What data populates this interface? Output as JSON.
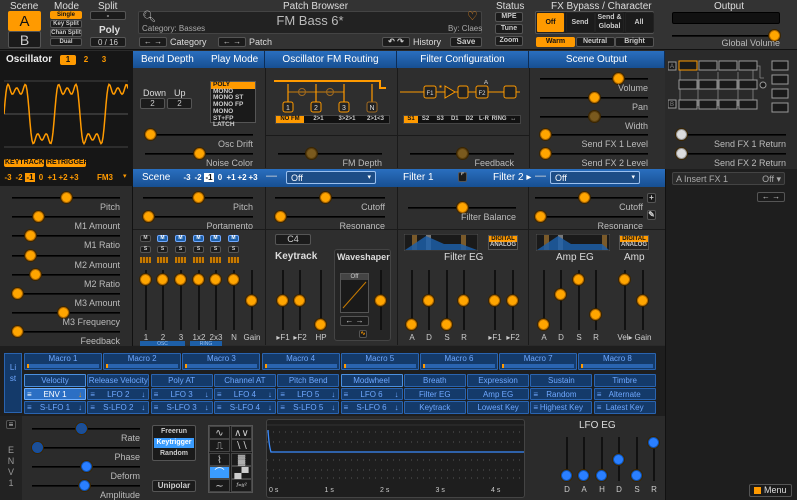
{
  "colors": {
    "accent": "#ff9a00",
    "header_blue": "#1d5fa8",
    "mod_blue": "#143a6a",
    "lfo_blue": "#2a7fff"
  },
  "top": {
    "scene_label": "Scene",
    "scene_a": "A",
    "scene_b": "B",
    "mode_label": "Mode",
    "modes": [
      "Single",
      "Key Split",
      "Chan Split",
      "Dual"
    ],
    "mode_selected": "Single",
    "split_label": "Split",
    "split_value": "-",
    "poly_label": "Poly",
    "poly_value": "0 / 16",
    "patch_browser_label": "Patch Browser",
    "patch_name": "FM Bass 6*",
    "category": "Category: Basses",
    "author": "By: Claes",
    "category_nav": "Category",
    "patch_nav": "Patch",
    "history": "History",
    "save": "Save",
    "status_label": "Status",
    "status_buttons": [
      "MPE",
      "Tune",
      "Zoom"
    ],
    "fx_label": "FX Bypass / Character",
    "fx_bypass": [
      "Off",
      "Send",
      "Send & Global",
      "All"
    ],
    "fx_selected": "Off",
    "character": [
      "Warm",
      "Neutral",
      "Bright"
    ],
    "character_selected": "Warm",
    "output_label": "Output",
    "global_volume": {
      "label": "Global Volume",
      "value": 1.0
    }
  },
  "osc": {
    "title": "Oscillator",
    "tabs": [
      "1",
      "2",
      "3"
    ],
    "selected_tab": "1",
    "keytrack": "KEYTRACK",
    "retrigger": "RETRIGGER",
    "octaves": [
      "-3",
      "-2",
      "-1",
      "0",
      "+1",
      "+2",
      "+3"
    ],
    "octave_selected": "-1",
    "type": "FM3",
    "sliders": [
      {
        "label": "Pitch",
        "value": 0.5
      },
      {
        "label": "M1 Amount",
        "value": 0.22
      },
      {
        "label": "M1 Ratio",
        "value": 0.13
      },
      {
        "label": "M2 Amount",
        "value": 0.13
      },
      {
        "label": "M2 Ratio",
        "value": 0.19
      },
      {
        "label": "M3 Amount",
        "value": 0.0
      },
      {
        "label": "M3 Frequency",
        "value": 0.47
      },
      {
        "label": "Feedback",
        "value": 0.0
      }
    ]
  },
  "headers": {
    "bend": "Bend Depth",
    "play_mode": "Play Mode",
    "fm_routing": "Oscillator FM Routing",
    "filter_config": "Filter Configuration",
    "scene_output": "Scene Output"
  },
  "bend": {
    "down_label": "Down",
    "up_label": "Up",
    "down": "2",
    "up": "2"
  },
  "play_modes": [
    "POLY",
    "MONO",
    "MONO ST",
    "MONO FP",
    "MONO ST+FP",
    "LATCH"
  ],
  "play_mode_selected": "POLY",
  "fm_modes": [
    "NO FM",
    "2>1",
    "3>2>1",
    "2>1<3"
  ],
  "fm_selected": "NO FM",
  "filter_modes": [
    "S1",
    "S2",
    "S3",
    "D1",
    "D2",
    "L-R",
    "RING",
    "↔"
  ],
  "filter_mode_selected": "S1",
  "upper_sliders": {
    "osc_drift": {
      "label": "Osc Drift",
      "value": 0.0
    },
    "noise_color": {
      "label": "Noise Color",
      "value": 0.5
    },
    "fm_depth": {
      "label": "FM Depth",
      "value": 0.3
    },
    "feedback": {
      "label": "Feedback",
      "value": 0.5
    },
    "volume": {
      "label": "Volume",
      "value": 0.75
    },
    "pan": {
      "label": "Pan",
      "value": 0.5
    },
    "width": {
      "label": "Width",
      "value": 0.5
    },
    "send1": {
      "label": "Send FX 1 Level",
      "value": 0.0
    },
    "send2": {
      "label": "Send FX 2 Level",
      "value": 0.0
    },
    "ret1": {
      "label": "Send FX 1 Return",
      "value": 0.0
    },
    "ret2": {
      "label": "Send FX 2 Return",
      "value": 0.0
    }
  },
  "scene_bar": {
    "label": "Scene",
    "octaves": [
      "-3",
      "-2",
      "-1",
      "0",
      "+1",
      "+2",
      "+3"
    ],
    "octave_selected": "-1",
    "filter1_type": "Off",
    "filter1": "Filter 1",
    "filter2": "Filter 2 ▸",
    "filter2_type": "Off"
  },
  "mid_sliders": {
    "pitch": {
      "label": "Pitch",
      "value": 0.5
    },
    "portamento": {
      "label": "Portamento",
      "value": 0.0
    },
    "cutoff1": {
      "label": "Cutoff",
      "value": 0.45
    },
    "res1": {
      "label": "Resonance",
      "value": 0.0
    },
    "balance": {
      "label": "Filter Balance",
      "value": 0.5
    },
    "cutoff2": {
      "label": "Cutoff",
      "value": 0.45
    },
    "res2": {
      "label": "Resonance",
      "value": 0.0
    }
  },
  "mixer": {
    "channels": [
      {
        "label": "1",
        "value": 0.92
      },
      {
        "label": "2",
        "value": 0.92
      },
      {
        "label": "3",
        "value": 0.92
      },
      {
        "label": "1x2",
        "value": 0.92
      },
      {
        "label": "2x3",
        "value": 0.92
      },
      {
        "label": "N",
        "value": 0.92
      },
      {
        "label": "Gain",
        "value": 0.5
      }
    ],
    "mute": "M",
    "solo": "S",
    "osc_group": "OSC",
    "ring_group": "RING"
  },
  "keytrack": {
    "note": "C4",
    "label": "Keytrack",
    "sliders": [
      {
        "label": "▸F1",
        "value": 0.5
      },
      {
        "label": "▸F2",
        "value": 0.5
      },
      {
        "label": "HP",
        "value": 0.0
      }
    ]
  },
  "waveshaper": {
    "label": "Waveshaper",
    "type": "Off",
    "drive": 0.5
  },
  "filter_eg": {
    "label": "Filter EG",
    "digital": "DIGITAL",
    "analog": "ANALOG",
    "sliders": [
      {
        "label": "A",
        "value": 0.0
      },
      {
        "label": "D",
        "value": 0.5
      },
      {
        "label": "S",
        "value": 0.0
      },
      {
        "label": "R",
        "value": 0.5
      },
      {
        "label": "▸F1",
        "value": 0.5
      },
      {
        "label": "▸F2",
        "value": 0.5
      }
    ]
  },
  "amp_eg": {
    "label": "Amp EG",
    "amp_label": "Amp",
    "digital": "DIGITAL",
    "analog": "ANALOG",
    "sliders": [
      {
        "label": "A",
        "value": 0.0
      },
      {
        "label": "D",
        "value": 0.62
      },
      {
        "label": "S",
        "value": 0.92
      },
      {
        "label": "R",
        "value": 0.2
      },
      {
        "label": "Vel▸",
        "value": 0.92
      },
      {
        "label": "Gain",
        "value": 0.5
      }
    ]
  },
  "fx": {
    "insert": "A Insert FX 1",
    "insert_value": "Off ▾",
    "scene_a": "A",
    "scene_b": "B"
  },
  "modulation": {
    "list_label": "List",
    "macros": [
      "Macro 1",
      "Macro 2",
      "Macro 3",
      "Macro 4",
      "Macro 5",
      "Macro 6",
      "Macro 7",
      "Macro 8"
    ],
    "row1": [
      "Velocity",
      "Release Velocity",
      "Poly AT",
      "Channel AT",
      "Pitch Bend",
      "Modwheel",
      "Breath",
      "Expression",
      "Sustain",
      "Timbre"
    ],
    "row2": [
      "ENV 1",
      "LFO 2",
      "LFO 3",
      "LFO 4",
      "LFO 5",
      "LFO 6",
      "Filter EG",
      "Amp EG",
      "Random",
      "Alternate"
    ],
    "row3": [
      "S-LFO 1",
      "S-LFO 2",
      "S-LFO 3",
      "S-LFO 4",
      "S-LFO 5",
      "S-LFO 6",
      "Keytrack",
      "Lowest Key",
      "Highest Key",
      "Latest Key"
    ],
    "selected": "ENV 1"
  },
  "lfo": {
    "name": "ENV 1",
    "sliders": [
      {
        "label": "Rate",
        "value": 0.45
      },
      {
        "label": "Phase",
        "value": 0.0
      },
      {
        "label": "Deform",
        "value": 0.5
      },
      {
        "label": "Amplitude",
        "value": 0.48
      }
    ],
    "triggers": [
      "Freerun",
      "Keytrigger",
      "Random"
    ],
    "trigger_selected": "Keytrigger",
    "unipolar": "Unipolar",
    "shapes": [
      "sine-icon",
      "triangle-icon",
      "square-icon",
      "sawtooth-icon",
      "noise-icon",
      "sample-hold-icon",
      "envelope-icon",
      "stepseq-icon",
      "function-icon",
      "formula-icon"
    ],
    "shape_selected": "envelope-icon",
    "formula_text": "f=x²",
    "time_labels": [
      "0 s",
      "1 s",
      "2 s",
      "3 s",
      "4 s"
    ],
    "eg_label": "LFO EG",
    "eg": [
      {
        "label": "D",
        "value": 0.0
      },
      {
        "label": "A",
        "value": 0.0
      },
      {
        "label": "H",
        "value": 0.0
      },
      {
        "label": "D",
        "value": 0.5
      },
      {
        "label": "S",
        "value": 0.0
      },
      {
        "label": "R",
        "value": 1.0
      }
    ]
  },
  "menu": "Menu"
}
